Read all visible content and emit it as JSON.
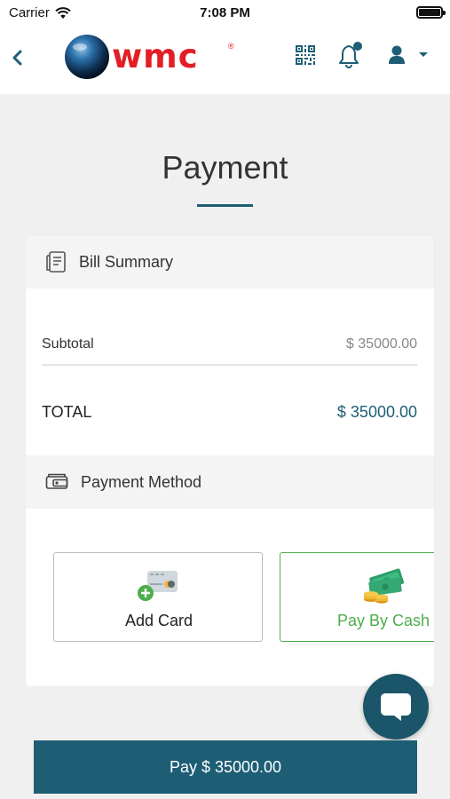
{
  "status_bar": {
    "carrier": "Carrier",
    "time": "7:08 PM"
  },
  "navbar": {
    "logo_text": "wmc",
    "logo_mark": "®",
    "icons": [
      "chevron-left-icon",
      "qr-code-icon",
      "bell-icon",
      "user-icon",
      "caret-down-icon"
    ],
    "notification_dot": true
  },
  "page": {
    "title": "Payment"
  },
  "bill_summary": {
    "heading": "Bill Summary",
    "subtotal_label": "Subtotal",
    "subtotal_value": "$ 35000.00",
    "total_label": "TOTAL",
    "total_value": "$ 35000.00"
  },
  "payment_method": {
    "heading": "Payment Method",
    "options": [
      {
        "label": "Add Card",
        "icon": "add-card-icon",
        "selected": false
      },
      {
        "label": "Pay By Cash",
        "icon": "cash-icon",
        "selected": true
      }
    ]
  },
  "pay_button": {
    "label": "Pay $ 35000.00"
  },
  "colors": {
    "primary": "#1d5e75",
    "brand_red": "#e31e25",
    "selected_green": "#4cae4c",
    "background": "#f0f0f0"
  }
}
